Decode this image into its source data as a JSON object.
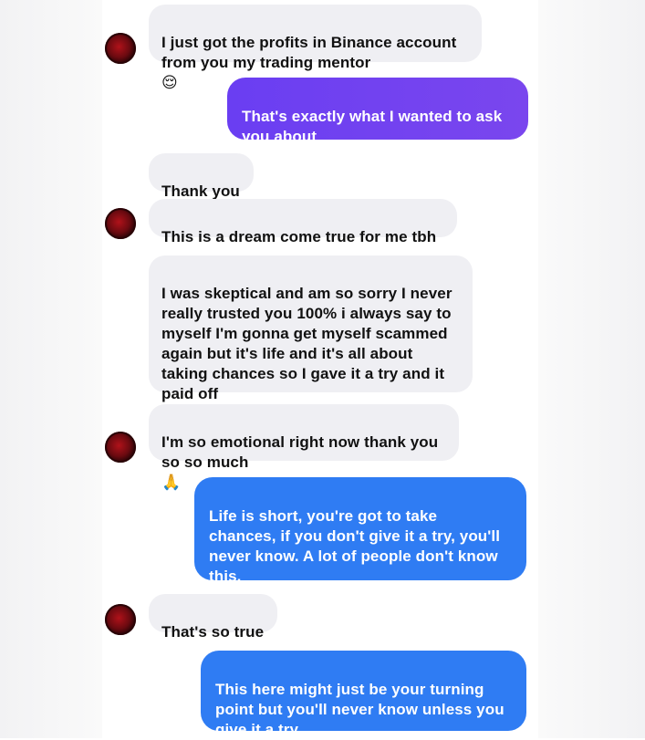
{
  "messages": [
    {
      "side": "in",
      "text": "I just got the profits in Binance account\nfrom you my trading mentor",
      "emoji": "😌"
    },
    {
      "side": "out",
      "text": "That's exactly what I wanted to ask\nyou about"
    },
    {
      "side": "in",
      "text": "Thank you"
    },
    {
      "side": "in",
      "text": "This is a dream come true for me tbh"
    },
    {
      "side": "in",
      "text": "I was skeptical and am so sorry I never\nreally trusted you 100% i always say to\nmyself I'm gonna get myself scammed\nagain but it's life and it's all about\ntaking chances so I gave it a try and it\npaid off"
    },
    {
      "side": "in",
      "text": "I'm so emotional right now thank you\nso so much",
      "emoji": "🙏"
    },
    {
      "side": "out",
      "text": "Life is short, you're got to take\nchances, if you don't give it a try, you'll\nnever know. A lot of people don't know\nthis."
    },
    {
      "side": "in",
      "text": "That's so true"
    },
    {
      "side": "out",
      "text": "This here might just be your turning\npoint but you'll never know unless you\ngive it a try"
    }
  ],
  "colors": {
    "incoming_bubble": "#efeff3",
    "outgoing_purple": "#6a3ef2",
    "outgoing_blue": "#2f7cf3"
  }
}
